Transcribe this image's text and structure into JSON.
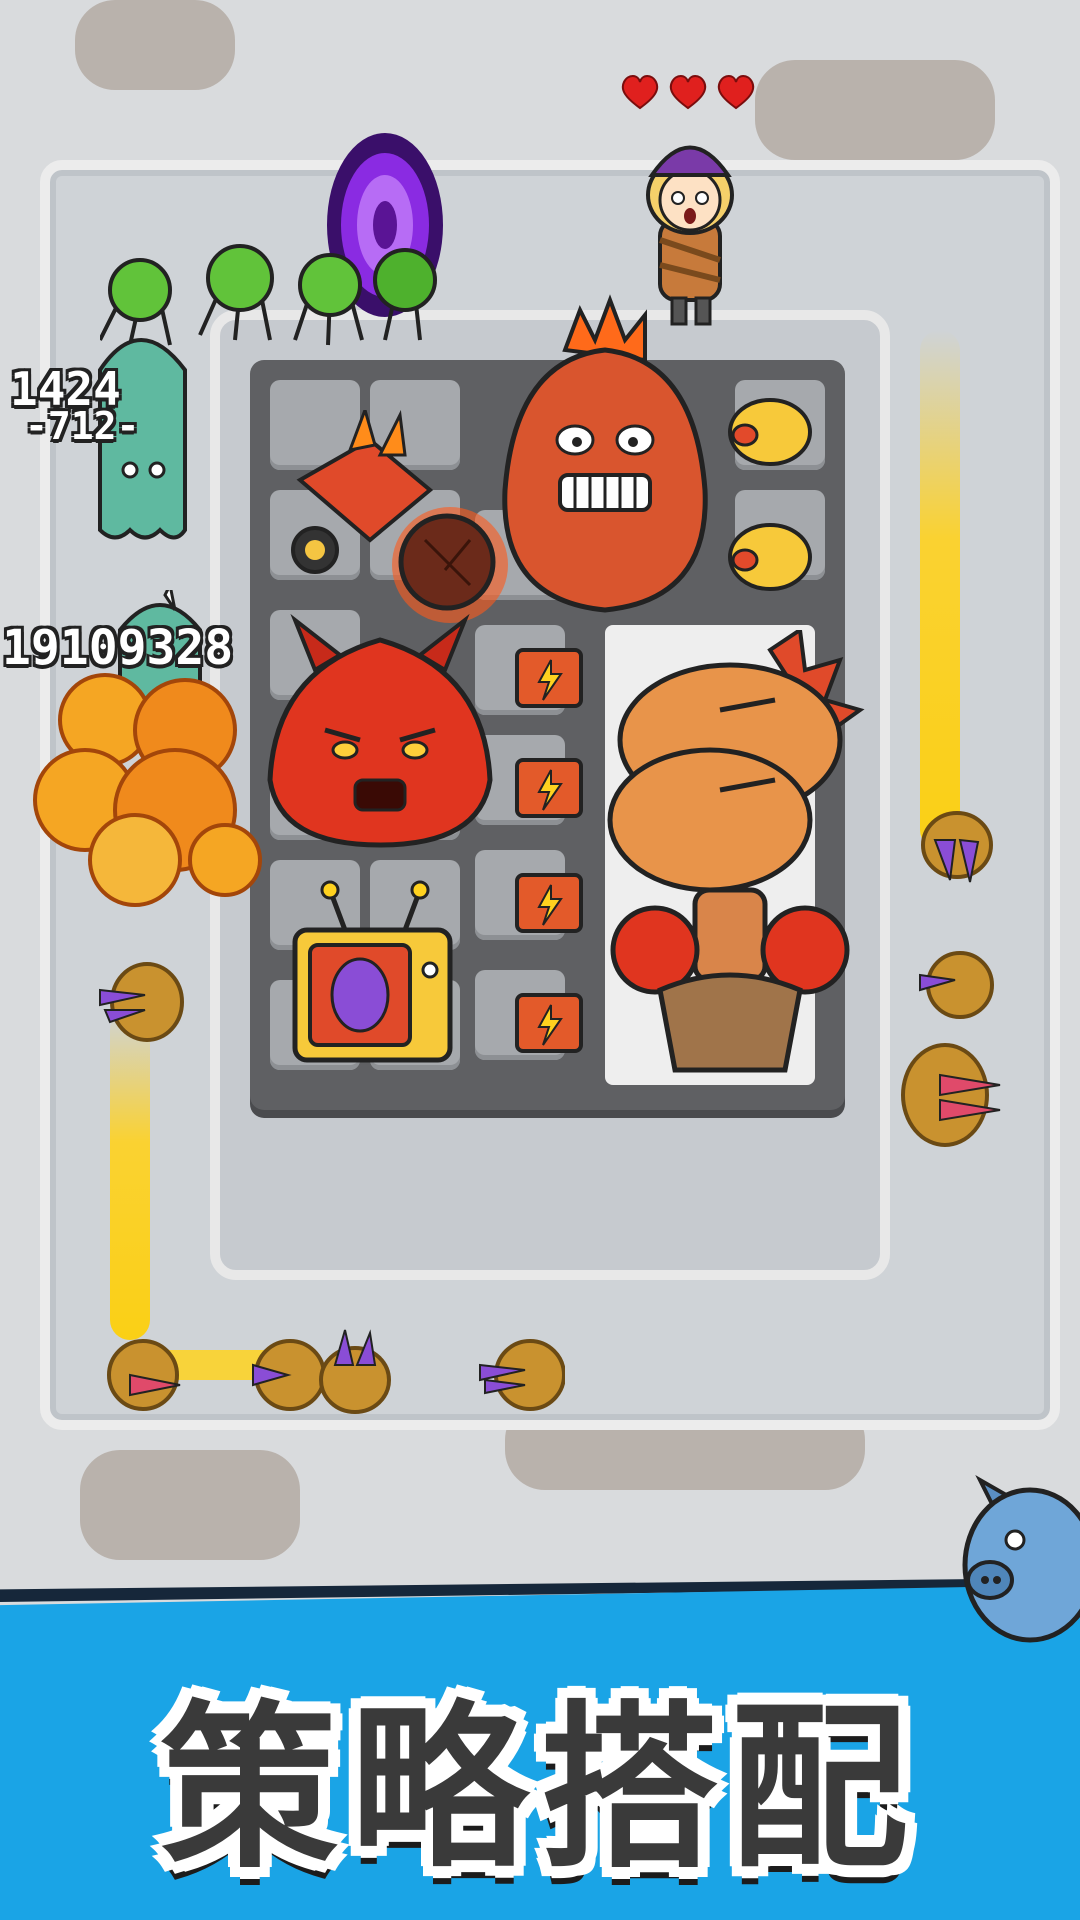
{
  "hud": {
    "hearts": 3,
    "heart_color": "#e0201e"
  },
  "damage_numbers": [
    "1424",
    "-712-",
    "19109328"
  ],
  "banner": {
    "title": "策略搭配",
    "color": "#1aa4e6"
  },
  "colors": {
    "background": "#d9dbdd",
    "board": "#5f6063",
    "lane_fire": "#ffd21f"
  },
  "icons": {
    "portal": "purple-portal-icon",
    "pig": "blue-pig-mascot-icon",
    "monster_boss": "red-spiky-monster-icon",
    "fire_monster": "fire-horned-monster-icon",
    "boxer_tower": "boxing-glove-tower-icon",
    "tv_egg": "tv-rainbow-egg-icon",
    "battery": "battery-lightning-icon",
    "nest": "crystal-nest-icon",
    "piggy_bank": "gold-piggy-bank-icon"
  }
}
